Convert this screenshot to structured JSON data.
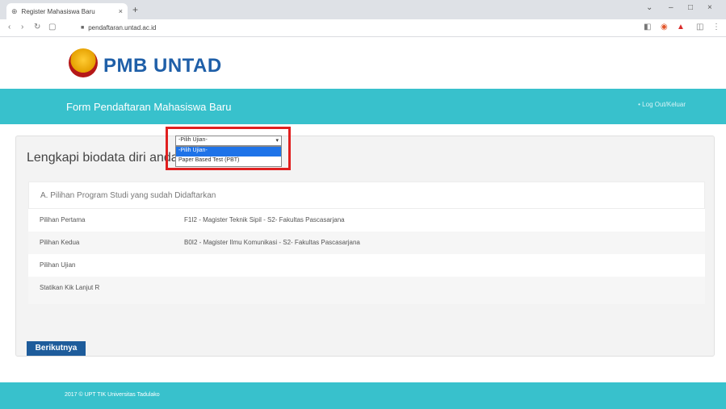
{
  "browser": {
    "tab_title": "Register Mahasiswa Baru",
    "tab_close": "×",
    "new_tab": "+",
    "url": "pendaftaran.untad.ac.id",
    "win_min": "–",
    "win_max": "□",
    "win_close": "×"
  },
  "header": {
    "logo_text": "PMB UNTAD",
    "band_title": "Form Pendaftaran Mahasiswa Baru",
    "logout_label": "• Log Out/Keluar"
  },
  "main": {
    "panel_title": "Lengkapi biodata diri anda dengan benar",
    "section_title": "A. Pilihan Program Studi yang sudah Didaftarkan",
    "rows": [
      {
        "label": "Pilihan Pertama",
        "value": "F1I2 - Magister Teknik Sipil - S2- Fakultas Pascasarjana"
      },
      {
        "label": "Pilihan Kedua",
        "value": "B0I2 - Magister Ilmu Komunikasi - S2- Fakultas Pascasarjana"
      },
      {
        "label": "Pilihan Ujian",
        "value": ""
      },
      {
        "label": "Statikan Kik Lanjut R",
        "value": ""
      }
    ],
    "select": {
      "current": "-Pilih Ujian-",
      "options": [
        "-Pilih Ujian-",
        "Paper Based Test (PBT)"
      ]
    },
    "next_button": "Berikutnya"
  },
  "footer": {
    "text": "2017 © UPT TIK Universitas Tadulako"
  },
  "colors": {
    "accent": "#38c1cc",
    "brand_blue": "#1f5fa8",
    "button": "#1e5c9b",
    "highlight": "#e02020"
  }
}
